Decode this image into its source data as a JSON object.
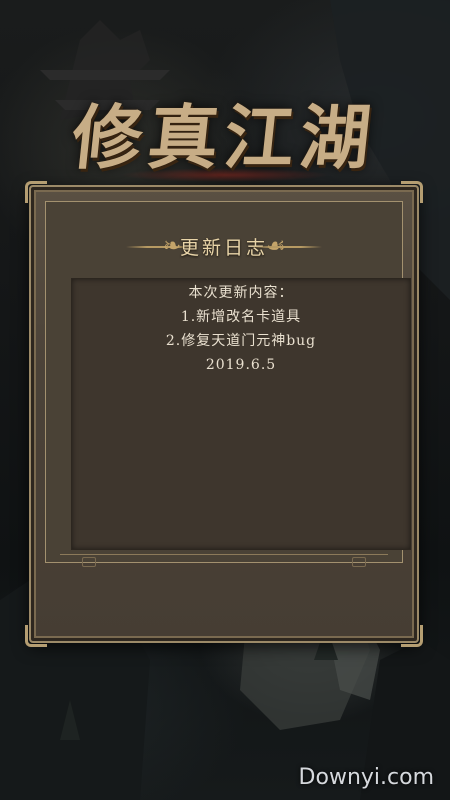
{
  "game_title": "修真江湖",
  "dialog": {
    "title": "更新日志",
    "lines": [
      "本次更新内容：",
      "1.新增改名卡道具",
      "2.修复天道门元神bug",
      "2019.6.5"
    ]
  },
  "watermark": "Downyi.com",
  "colors": {
    "panel": "#4b4238",
    "frame_gold": "#b59e72",
    "title_gold": "#c7ad86",
    "text": "#e9e0cf"
  }
}
